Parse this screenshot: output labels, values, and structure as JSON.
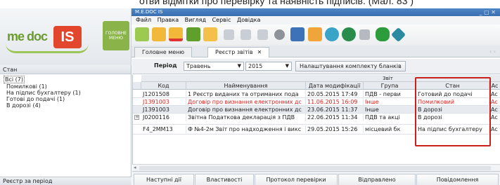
{
  "caption": "отви відмітки про перевірку та наявність підписів. (Мал. 83 )",
  "logo": {
    "me": "me",
    "doc": "doc",
    "is": "IS",
    "home_tile": "ГОЛОВНЕ МЕНЮ"
  },
  "window": {
    "title": "M.E.DOC IS",
    "controls": "_ ▢ ✕"
  },
  "menu": [
    "Файл",
    "Правка",
    "Вигляд",
    "Сервіс",
    "Довідка"
  ],
  "toolbar_icons": [
    "add-icon",
    "open-folder-icon",
    "delete-folder-icon",
    "green-document-icon",
    "folder-icon",
    "document-add-icon",
    "document-list-icon",
    "document-delete-icon",
    "stamp-icon",
    "printer-icon",
    "folder-send-icon",
    "globe-icon",
    "gear-icon",
    "document-check-icon",
    "shield-check-icon",
    "puzzle-icon"
  ],
  "tabs": [
    {
      "label": "Головне меню"
    },
    {
      "label": "Реєстр звітів",
      "close": "✕"
    }
  ],
  "left_panel": {
    "header": "Стан",
    "tree": [
      {
        "label": "Всі (7)",
        "root": true
      },
      {
        "label": "Помилкові (1)"
      },
      {
        "label": "На підпис бухгалтеру (1)"
      },
      {
        "label": "Готові до подачі (1)"
      },
      {
        "label": "В дорозі (4)"
      }
    ],
    "footer": "Реєстр за період"
  },
  "filter": {
    "period_label": "Період",
    "month": "Травень",
    "year": "2015",
    "settings_button": "Налаштування комплекту бланків"
  },
  "grid": {
    "group_header": "Звіт",
    "columns": [
      "Код",
      "Найменування",
      "Дата модифікації",
      "Група",
      "Стан",
      "Ac"
    ],
    "rows": [
      {
        "code": "J1201508",
        "name": "1 Реєстр виданих та отриманих пода",
        "date": "20.05.2015 17:49",
        "group": "ПДВ - перви",
        "state": "Готовий до подачі",
        "extra": "Ac",
        "style": "normal"
      },
      {
        "code": "J1391003",
        "name": "Договір про визнання електронних дс",
        "date": "11.06.2015 16:09",
        "group": "Інше",
        "state": "Помилковий",
        "extra": "Ac",
        "style": "red"
      },
      {
        "code": "J1391003",
        "name": "Договір про визнання електронних дс",
        "date": "23.06.2015 11:37",
        "group": "Інше",
        "state": "В дорозі",
        "extra": "Ac",
        "style": "selected"
      },
      {
        "code": "J0200116",
        "name": "Звітна Податкова декларація з ПДВ",
        "date": "22.06.2015 11:34",
        "group": "ПДВ та акці",
        "state": "В дорозі",
        "extra": "Ac",
        "style": "normal",
        "expander": "+"
      },
      {
        "code": "F4_2MM13",
        "name": "Ф №4-2м Звіт про надходження і викс",
        "date": "29.05.2015 15:26",
        "group": "місцевий бк",
        "state": "На підпис бухгалтеру",
        "extra": "Ac",
        "style": "normal"
      }
    ]
  },
  "bottom_tabs": [
    "Наступні дії",
    "Властивості",
    "Протокол перевірки",
    "Відправлено",
    "Повідомлення"
  ],
  "colors": {
    "accent_red": "#c8201a",
    "error_text": "#e0211c",
    "title_bar": "#3a6fb0",
    "logo_green": "#6a9b2d",
    "logo_red": "#e2472e"
  }
}
